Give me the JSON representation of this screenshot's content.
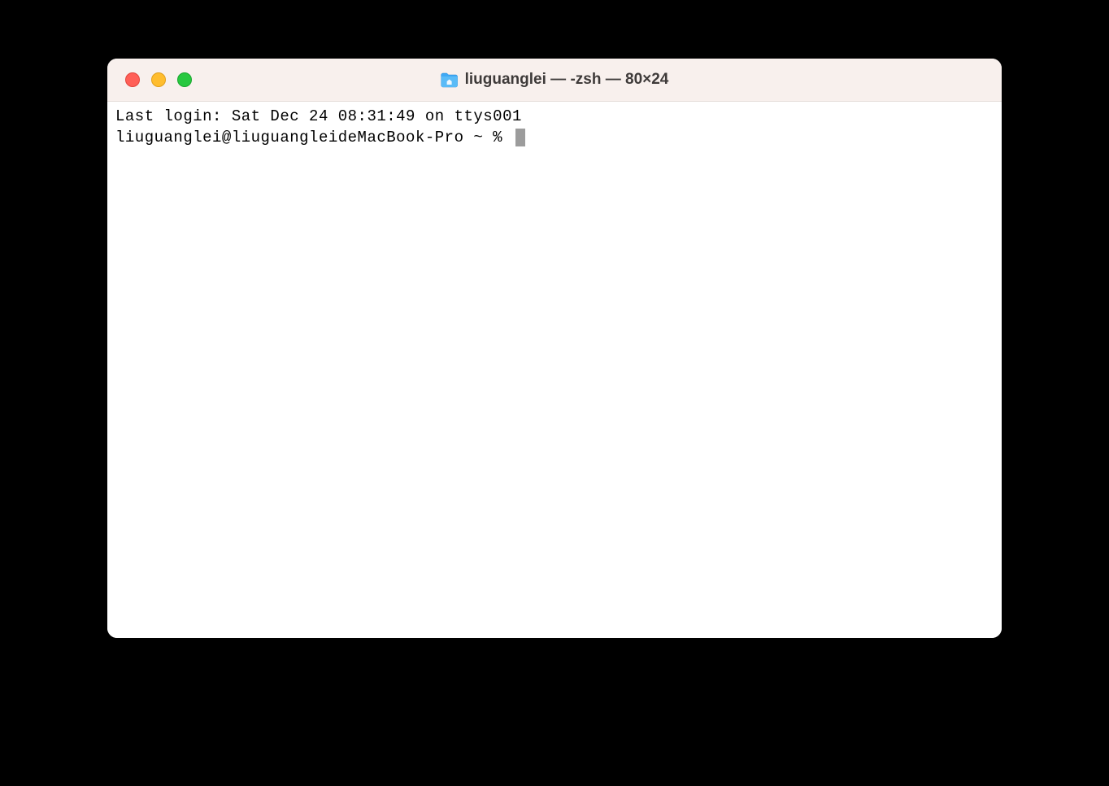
{
  "window": {
    "title": "liuguanglei — -zsh — 80×24"
  },
  "terminal": {
    "lines": [
      "Last login: Sat Dec 24 08:31:49 on ttys001"
    ],
    "prompt": "liuguanglei@liuguangleideMacBook-Pro ~ % "
  }
}
